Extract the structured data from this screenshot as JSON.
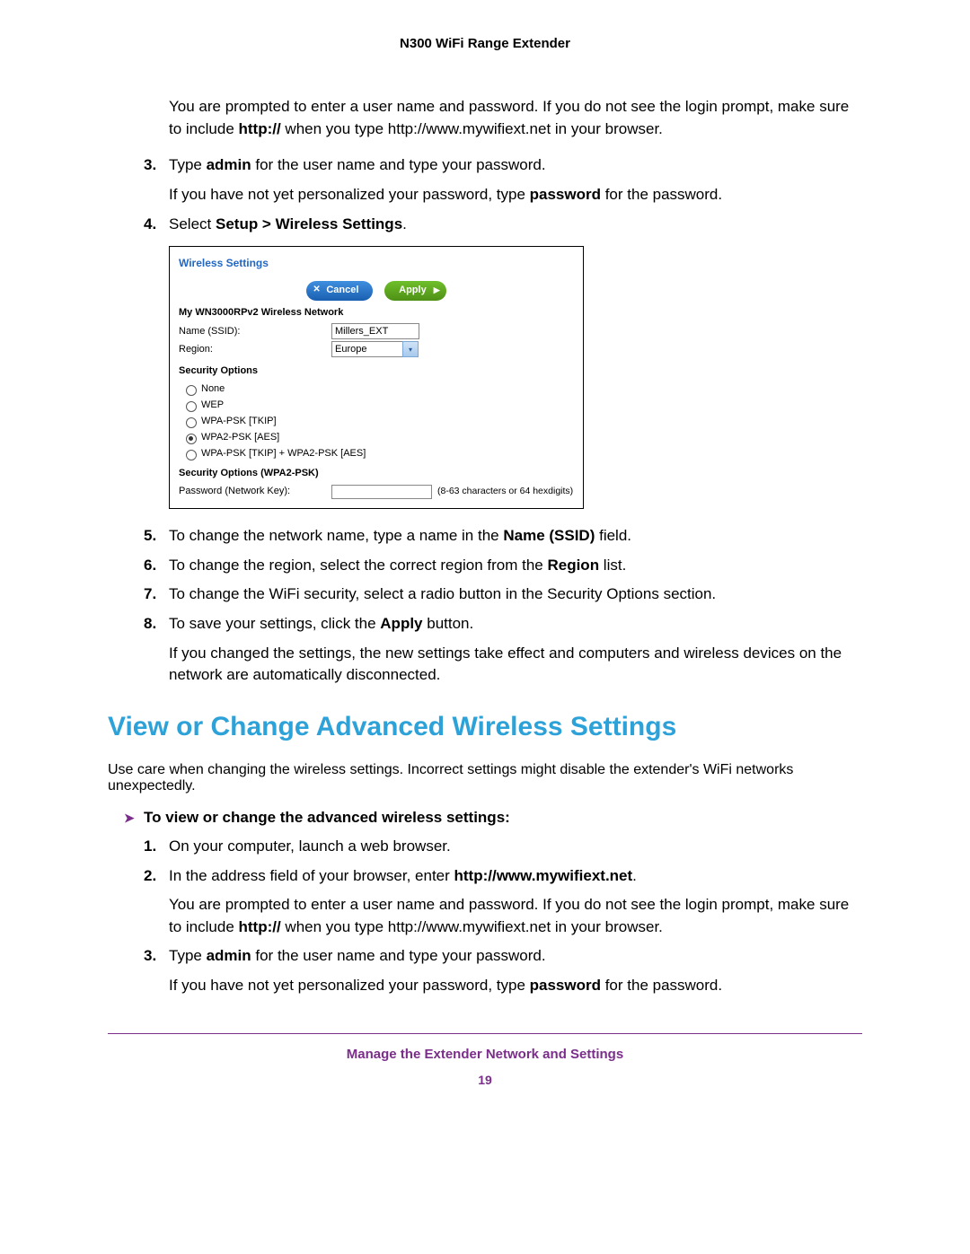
{
  "header": {
    "title": "N300 WiFi Range Extender"
  },
  "intro": {
    "p1a": "You are prompted to enter a user name and password. If you do not see the login prompt, make sure to include ",
    "p1b": "http://",
    "p1c": " when you type http://www.mywifiext.net in your browser."
  },
  "steps_a": {
    "s3": {
      "num": "3.",
      "text_a": "Type ",
      "text_b": "admin",
      "text_c": " for the user name and type your password.",
      "sub_a": "If you have not yet personalized your password, type ",
      "sub_b": "password",
      "sub_c": " for the password."
    },
    "s4": {
      "num": "4.",
      "text_a": "Select ",
      "text_b": "Setup > Wireless Settings",
      "text_c": "."
    },
    "s5": {
      "num": "5.",
      "text_a": "To change the network name, type a name in the ",
      "text_b": "Name (SSID)",
      "text_c": " field."
    },
    "s6": {
      "num": "6.",
      "text_a": "To change the region, select the correct region from the ",
      "text_b": "Region",
      "text_c": " list."
    },
    "s7": {
      "num": "7.",
      "text": "To change the WiFi security, select a radio button in the Security Options section."
    },
    "s8": {
      "num": "8.",
      "text_a": "To save your settings, click the ",
      "text_b": "Apply",
      "text_c": " button.",
      "sub": "If you changed the settings, the new settings take effect and computers and wireless devices on the network are automatically disconnected."
    }
  },
  "screenshot": {
    "title": "Wireless Settings",
    "cancel": "Cancel",
    "apply": "Apply",
    "network_label": "My WN3000RPv2 Wireless Network",
    "name_label": "Name (SSID):",
    "name_value": "Millers_EXT",
    "region_label": "Region:",
    "region_value": "Europe",
    "sec_label": "Security Options",
    "opt_none": "None",
    "opt_wep": "WEP",
    "opt_wpa_tkip": "WPA-PSK [TKIP]",
    "opt_wpa2_aes": "WPA2-PSK [AES]",
    "opt_mixed": "WPA-PSK [TKIP] + WPA2-PSK [AES]",
    "sec2_label": "Security Options (WPA2-PSK)",
    "pw_label": "Password (Network Key):",
    "pw_hint": "(8-63 characters or 64 hexdigits)"
  },
  "heading": "View or Change Advanced Wireless Settings",
  "adv_intro": "Use care when changing the wireless settings. Incorrect settings might disable the extender's WiFi networks unexpectedly.",
  "task": "To view or change the advanced wireless settings:",
  "steps_b": {
    "s1": {
      "num": "1.",
      "text": "On your computer, launch a web browser."
    },
    "s2": {
      "num": "2.",
      "text_a": "In the address field of your browser, enter ",
      "text_b": "http://www.mywifiext.net",
      "text_c": ".",
      "sub_a": "You are prompted to enter a user name and password. If you do not see the login prompt, make sure to include ",
      "sub_b": "http://",
      "sub_c": " when you type http://www.mywifiext.net in your browser."
    },
    "s3": {
      "num": "3.",
      "text_a": "Type ",
      "text_b": "admin",
      "text_c": " for the user name and type your password.",
      "sub_a": "If you have not yet personalized your password, type ",
      "sub_b": "password",
      "sub_c": " for the password."
    }
  },
  "footer": {
    "chapter": "Manage the Extender Network and Settings",
    "page": "19"
  }
}
